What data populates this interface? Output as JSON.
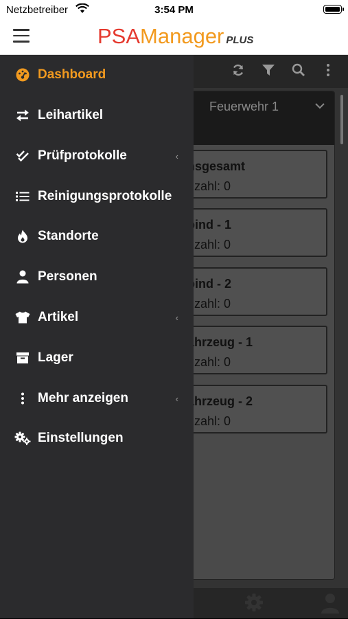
{
  "status_bar": {
    "carrier": "Netzbetreiber",
    "time": "3:54 PM"
  },
  "header": {
    "brand_psa": "PSA",
    "brand_manager": "Manager",
    "brand_plus": "PLUS"
  },
  "background": {
    "panel_title": "Feuerwehr 1",
    "cards": [
      {
        "name": "nsgesamt",
        "count": "nzahl: 0"
      },
      {
        "name": "pind - 1",
        "count": "nzahl: 0"
      },
      {
        "name": "pind - 2",
        "count": "nzahl: 0"
      },
      {
        "name": "ahrzeug - 1",
        "count": "nzahl: 0"
      },
      {
        "name": "ahrzeug - 2",
        "count": "nzahl: 0"
      }
    ]
  },
  "drawer": {
    "items": [
      {
        "label": "Dashboard",
        "icon": "dashboard-icon",
        "active": true
      },
      {
        "label": "Leihartikel",
        "icon": "exchange-icon"
      },
      {
        "label": "Prüfprotokolle",
        "icon": "check-double-icon",
        "submenu": true
      },
      {
        "label": "Reinigungsprotokolle",
        "icon": "list-icon"
      },
      {
        "label": "Standorte",
        "icon": "fire-icon"
      },
      {
        "label": "Personen",
        "icon": "person-icon"
      },
      {
        "label": "Artikel",
        "icon": "shirt-icon",
        "submenu": true
      },
      {
        "label": "Lager",
        "icon": "archive-icon"
      },
      {
        "label": "Mehr anzeigen",
        "icon": "more-vertical-icon",
        "submenu": true
      },
      {
        "label": "Einstellungen",
        "icon": "cogs-icon"
      }
    ]
  },
  "colors": {
    "accent": "#f29a1f",
    "brand_red": "#e53a2f",
    "drawer_bg": "#2b2b2d"
  }
}
